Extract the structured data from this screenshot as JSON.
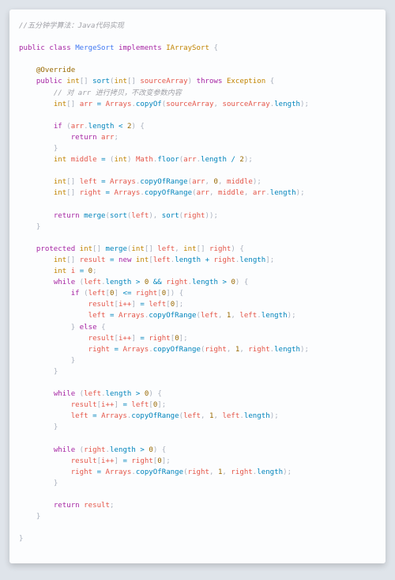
{
  "header_comment": "//五分钟学算法：Java代码实现",
  "decl": {
    "public": "public",
    "class_kw": "class",
    "class_name": "MergeSort",
    "implements": "implements",
    "iface": "IArraySort",
    "lbrace": "{"
  },
  "annot_override": "@Override",
  "sort_sig": {
    "public": "public",
    "ret_type": "int",
    "brackets": "[]",
    "name": "sort",
    "param_type": "int",
    "param_name": "sourceArray",
    "throws": "throws",
    "exc": "Exception",
    "lbrace": "{"
  },
  "sort_body": {
    "comment_copy": "// 对 arr 进行拷贝，不改变参数内容",
    "arr_decl_type": "int",
    "arr_name": "arr",
    "eq": "=",
    "Arrays": "Arrays",
    "copyOf": "copyOf",
    "sourceArray": "sourceArray",
    "length": "length",
    "if_kw": "if",
    "lt": "<",
    "two": "2",
    "return_kw": "return",
    "middle_type": "int",
    "middle": "middle",
    "int_cast": "int",
    "Math": "Math",
    "floor": "floor",
    "slash": "/",
    "left": "left",
    "right": "right",
    "copyOfRange": "copyOfRange",
    "zero": "0",
    "merge": "merge",
    "sort": "sort"
  },
  "merge_sig": {
    "protected": "protected",
    "ret_type": "int",
    "brackets": "[]",
    "name": "merge",
    "param_type": "int",
    "left": "left",
    "right": "right",
    "lbrace": "{"
  },
  "merge_body": {
    "result_type": "int",
    "result": "result",
    "new_kw": "new",
    "int_kw": "int",
    "left": "left",
    "length": "length",
    "plus": "+",
    "right": "right",
    "i_type": "int",
    "i": "i",
    "eq": "=",
    "zero": "0",
    "while_kw": "while",
    "gt": ">",
    "andand": "&&",
    "if_kw": "if",
    "lteq": "<=",
    "ipp": "i++",
    "Arrays": "Arrays",
    "copyOfRange": "copyOfRange",
    "one": "1",
    "else_kw": "else",
    "return_kw": "return"
  },
  "punct": {
    "lbrace": "{",
    "rbrace": "}",
    "lparen": "(",
    "rparen": ")",
    "lbrack": "[",
    "rbrack": "]",
    "semi": ";",
    "comma": ",",
    "dot": "."
  }
}
